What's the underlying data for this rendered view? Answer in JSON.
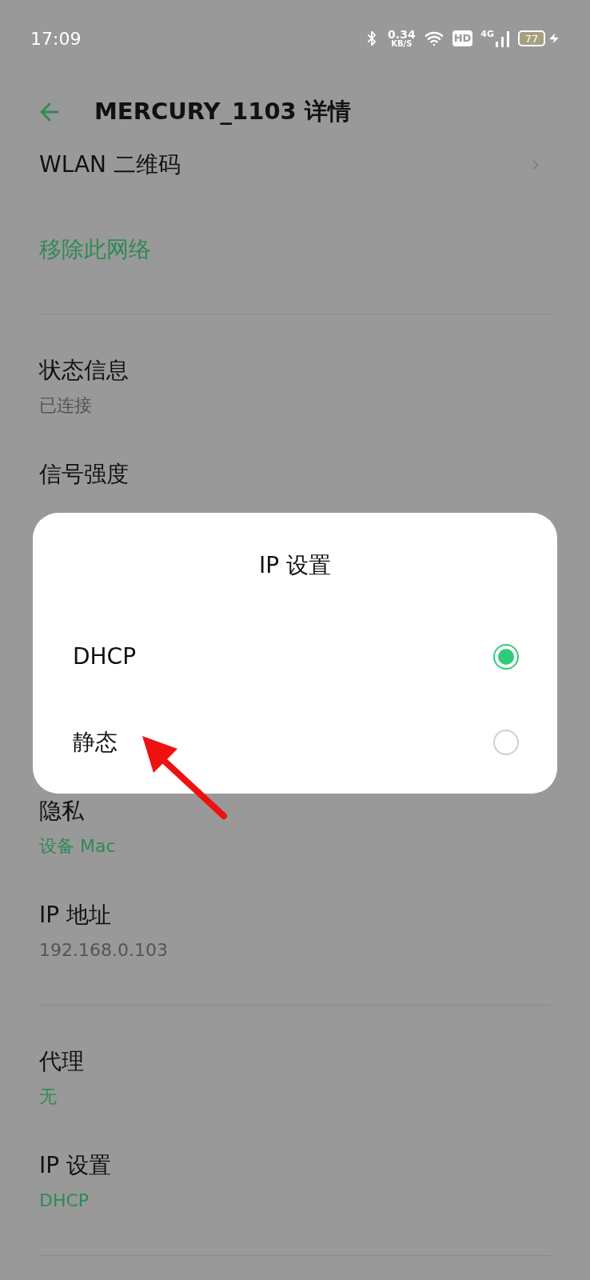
{
  "status_bar": {
    "time": "17:09",
    "speed_value": "0.34",
    "speed_unit": "KB/S",
    "hd_badge": "HD",
    "network_type": "4G",
    "battery": "77",
    "charging": true
  },
  "header": {
    "title": "MERCURY_1103 详情"
  },
  "settings_top": [
    {
      "kind": "nav",
      "title": "WLAN 二维码"
    },
    {
      "kind": "action",
      "title": "移除此网络"
    },
    {
      "kind": "divider"
    },
    {
      "kind": "detail",
      "title": "状态信息",
      "value": "已连接",
      "accent": false
    },
    {
      "kind": "detail",
      "title": "信号强度"
    }
  ],
  "dialog": {
    "title": "IP 设置",
    "options": [
      {
        "label": "DHCP",
        "selected": true
      },
      {
        "label": "静态",
        "selected": false
      }
    ]
  },
  "settings_bottom": [
    {
      "kind": "detail",
      "title": "隐私",
      "value": "设备 Mac",
      "accent": true
    },
    {
      "kind": "detail",
      "title": "IP 地址",
      "value": "192.168.0.103",
      "accent": false
    },
    {
      "kind": "divider"
    },
    {
      "kind": "detail",
      "title": "代理",
      "value": "无",
      "accent": true
    },
    {
      "kind": "detail",
      "title": "IP 设置",
      "value": "DHCP",
      "accent": true
    },
    {
      "kind": "divider"
    }
  ]
}
